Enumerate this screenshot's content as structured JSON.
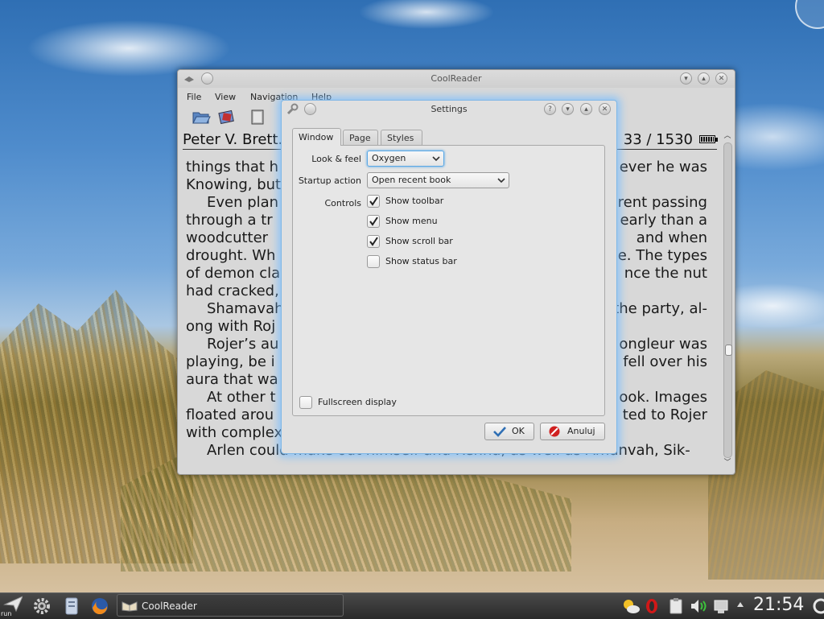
{
  "main_window": {
    "title": "CoolReader",
    "menu": [
      "File",
      "View",
      "Navigation",
      "Help"
    ],
    "book_author": "Peter V. Brett.",
    "page_position": "33 / 1530",
    "book_text": [
      {
        "left": "things that h",
        "right": "ever he was"
      },
      {
        "left": "Knowing, but",
        "right": ""
      },
      {
        "left": "Even plan",
        "right": "rent passing"
      },
      {
        "left": "through a tr",
        "right": "early than a"
      },
      {
        "left": "woodcutter",
        "right": "and when"
      },
      {
        "left": "drought. Wh",
        "right": "e. The types"
      },
      {
        "left": "of demon cla",
        "right": "nce the nut"
      },
      {
        "left": "had cracked,",
        "right": ""
      },
      {
        "left": "Shamavah",
        "right": "the party, al-"
      },
      {
        "left": "ong with Roj",
        "right": ""
      },
      {
        "left": "Rojer’s au",
        "right": "ongleur was"
      },
      {
        "left": "playing, be i",
        "right": "fell over his"
      },
      {
        "left": "aura that wa",
        "right": ""
      },
      {
        "left": "At other t",
        "right": "ook. Images"
      },
      {
        "left": "floated arou",
        "right": "ted to Rojer"
      },
      {
        "left": "with complex",
        "right": ""
      },
      {
        "left": "Arlen could make out himself and Renna, as well as Amanvah, Sik-",
        "right": ""
      }
    ]
  },
  "settings_dialog": {
    "title": "Settings",
    "tabs": [
      "Window",
      "Page",
      "Styles"
    ],
    "active_tab": "Window",
    "look_and_feel": {
      "label": "Look & feel",
      "value": "Oxygen"
    },
    "startup_action": {
      "label": "Startup action",
      "value": "Open recent book"
    },
    "controls_label": "Controls",
    "controls": [
      {
        "label": "Show toolbar",
        "checked": true
      },
      {
        "label": "Show menu",
        "checked": true
      },
      {
        "label": "Show scroll bar",
        "checked": true
      },
      {
        "label": "Show status bar",
        "checked": false
      }
    ],
    "fullscreen": {
      "label": "Fullscreen display",
      "checked": false
    },
    "ok_label": "OK",
    "cancel_label": "Anuluj"
  },
  "taskbar": {
    "launcher_label": "run",
    "task_entry": "CoolReader",
    "clock": "21:54"
  },
  "colors": {
    "dialog_glow": "#78beff",
    "focus_border": "#5aa8e6",
    "ok_check": "#2f6fb4",
    "cancel_red": "#d02020"
  }
}
